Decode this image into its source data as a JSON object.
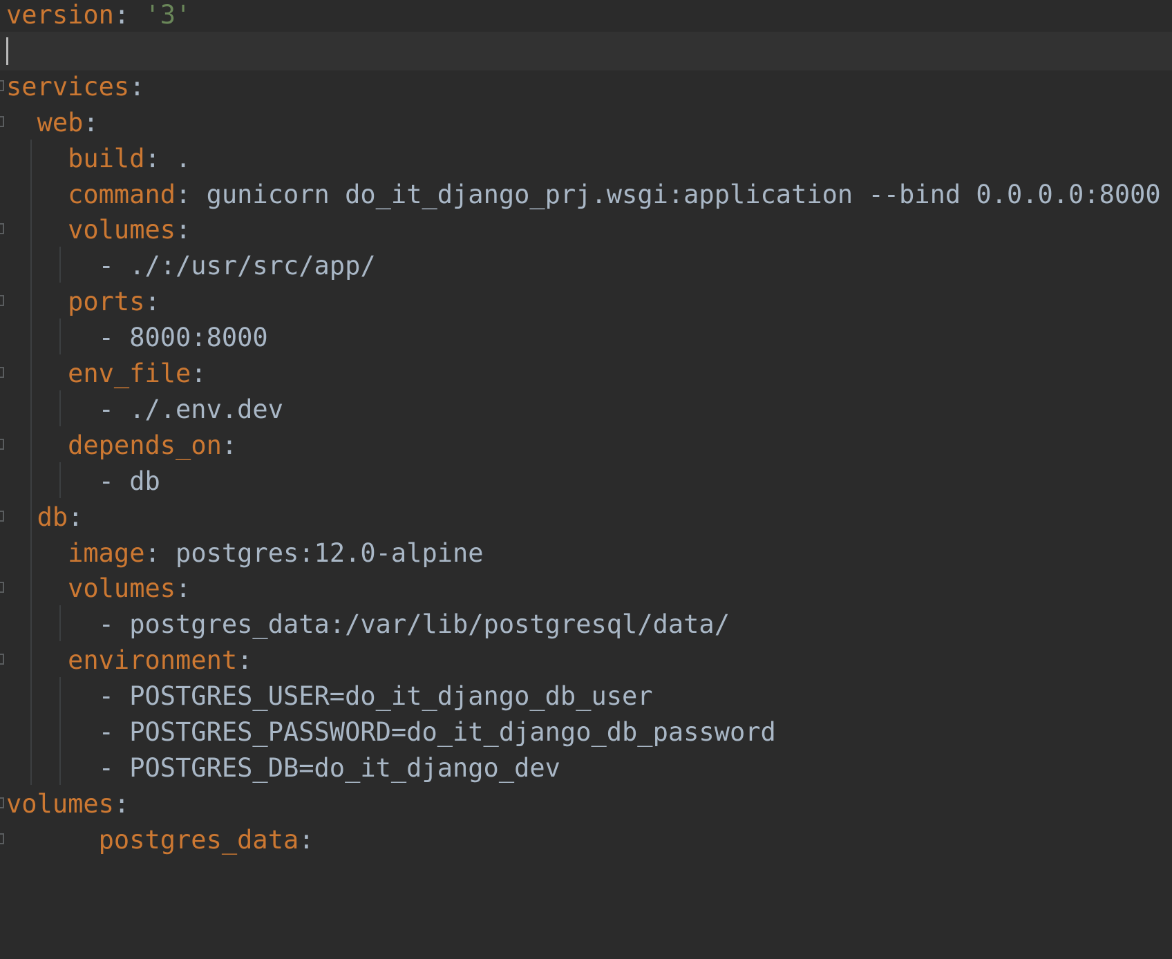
{
  "lines": [
    {
      "indent": "",
      "key": "version",
      "colon": ":",
      "value": " '3'",
      "value_type": "string"
    },
    {
      "indent": "",
      "key": "",
      "colon": "",
      "value": "",
      "value_type": "plain",
      "current": true
    },
    {
      "indent": "",
      "key": "services",
      "colon": ":",
      "value": "",
      "value_type": "plain"
    },
    {
      "indent": "  ",
      "key": "web",
      "colon": ":",
      "value": "",
      "value_type": "plain"
    },
    {
      "indent": "    ",
      "key": "build",
      "colon": ":",
      "value": " .",
      "value_type": "plain"
    },
    {
      "indent": "    ",
      "key": "command",
      "colon": ":",
      "value": " gunicorn do_it_django_prj.wsgi:application --bind 0.0.0.0:8000",
      "value_type": "plain"
    },
    {
      "indent": "    ",
      "key": "volumes",
      "colon": ":",
      "value": "",
      "value_type": "plain"
    },
    {
      "indent": "      ",
      "key": "",
      "colon": "",
      "value": "- ./:/usr/src/app/",
      "value_type": "plain"
    },
    {
      "indent": "    ",
      "key": "ports",
      "colon": ":",
      "value": "",
      "value_type": "plain"
    },
    {
      "indent": "      ",
      "key": "",
      "colon": "",
      "value": "- 8000:8000",
      "value_type": "plain"
    },
    {
      "indent": "    ",
      "key": "env_file",
      "colon": ":",
      "value": "",
      "value_type": "plain"
    },
    {
      "indent": "      ",
      "key": "",
      "colon": "",
      "value": "- ./.env.dev",
      "value_type": "plain"
    },
    {
      "indent": "    ",
      "key": "depends_on",
      "colon": ":",
      "value": "",
      "value_type": "plain"
    },
    {
      "indent": "      ",
      "key": "",
      "colon": "",
      "value": "- db",
      "value_type": "plain"
    },
    {
      "indent": "  ",
      "key": "db",
      "colon": ":",
      "value": "",
      "value_type": "plain"
    },
    {
      "indent": "    ",
      "key": "image",
      "colon": ":",
      "value": " postgres:12.0-alpine",
      "value_type": "plain"
    },
    {
      "indent": "    ",
      "key": "volumes",
      "colon": ":",
      "value": "",
      "value_type": "plain"
    },
    {
      "indent": "      ",
      "key": "",
      "colon": "",
      "value": "- postgres_data:/var/lib/postgresql/data/",
      "value_type": "plain"
    },
    {
      "indent": "    ",
      "key": "environment",
      "colon": ":",
      "value": "",
      "value_type": "plain"
    },
    {
      "indent": "      ",
      "key": "",
      "colon": "",
      "value": "- POSTGRES_USER=do_it_django_db_user",
      "value_type": "plain"
    },
    {
      "indent": "      ",
      "key": "",
      "colon": "",
      "value": "- POSTGRES_PASSWORD=do_it_django_db_password",
      "value_type": "plain"
    },
    {
      "indent": "      ",
      "key": "",
      "colon": "",
      "value": "- POSTGRES_DB=do_it_django_dev",
      "value_type": "plain"
    },
    {
      "indent": "",
      "key": "volumes",
      "colon": ":",
      "value": "",
      "value_type": "plain"
    },
    {
      "indent": "      ",
      "key": "postgres_data",
      "colon": ":",
      "value": "",
      "value_type": "plain"
    }
  ],
  "colors": {
    "background": "#2b2b2b",
    "current_line": "#323232",
    "key": "#cc7832",
    "string": "#6a8759",
    "text": "#a9b7c6"
  }
}
